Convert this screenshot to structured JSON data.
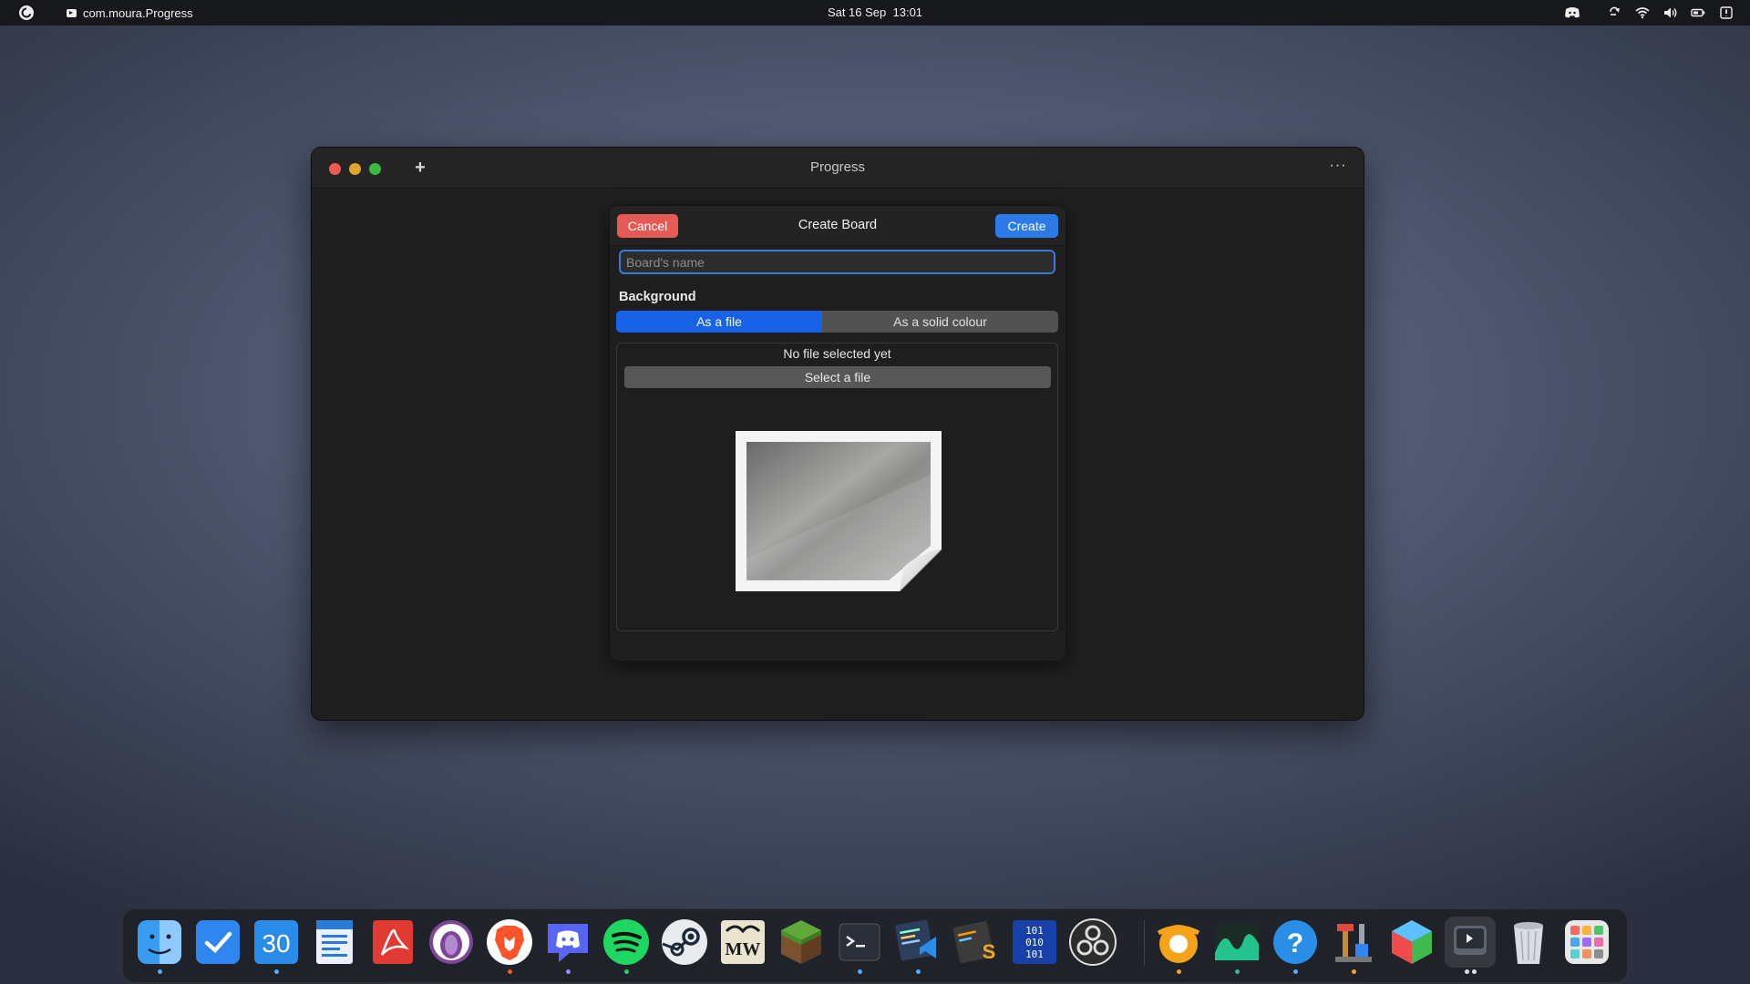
{
  "topbar": {
    "app_name": "com.moura.Progress",
    "date": "Sat 16 Sep",
    "time": "13:01",
    "tray_icons": [
      "discord-tray-icon",
      "screen-rotate-icon",
      "wifi-icon",
      "volume-icon",
      "battery-icon",
      "notifications-icon"
    ]
  },
  "window": {
    "title": "Progress",
    "add_label": "+",
    "more_label": "···"
  },
  "dialog": {
    "title": "Create Board",
    "cancel_label": "Cancel",
    "create_label": "Create",
    "name_placeholder": "Board's name",
    "name_value": "",
    "background_label": "Background",
    "tabs": [
      {
        "label": "As a file",
        "selected": true
      },
      {
        "label": "As a solid colour",
        "selected": false
      }
    ],
    "no_file_text": "No file selected yet",
    "select_file_label": "Select a file",
    "preview_icon": "image-placeholder-icon"
  },
  "dock": {
    "calendar_day": "30",
    "items": [
      {
        "name": "finder",
        "running": true
      },
      {
        "name": "tasks",
        "running": false
      },
      {
        "name": "calendar",
        "running": true
      },
      {
        "name": "writer",
        "running": false
      },
      {
        "name": "pdf-reader",
        "running": false
      },
      {
        "name": "tor-browser",
        "running": false
      },
      {
        "name": "brave",
        "running": true
      },
      {
        "name": "discord",
        "running": true
      },
      {
        "name": "spotify",
        "running": true
      },
      {
        "name": "steam",
        "running": false
      },
      {
        "name": "morrowind",
        "running": false
      },
      {
        "name": "minecraft",
        "running": false
      },
      {
        "name": "terminal",
        "running": true
      },
      {
        "name": "vscode",
        "running": true
      },
      {
        "name": "sublime-text",
        "running": false
      },
      {
        "name": "binary-editor",
        "running": false
      },
      {
        "name": "obs-studio",
        "running": false
      },
      {
        "name": "blender",
        "running": true
      },
      {
        "name": "system-monitor",
        "running": true
      },
      {
        "name": "help",
        "running": true
      },
      {
        "name": "dev-tools",
        "running": true
      },
      {
        "name": "box-app",
        "running": false
      },
      {
        "name": "progress-run",
        "running": true
      },
      {
        "name": "trash",
        "running": false
      },
      {
        "name": "app-grid",
        "running": false
      }
    ]
  }
}
